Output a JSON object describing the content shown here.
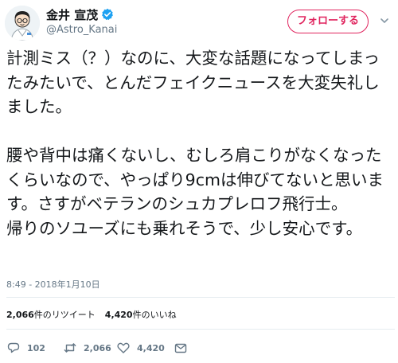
{
  "user": {
    "display_name": "金井 宣茂",
    "handle": "@Astro_Kanai",
    "verified_icon": "verified-badge-icon"
  },
  "follow_button": {
    "label": "フォローする"
  },
  "tweet": {
    "text": "計測ミス（？）なのに、大変な話題になってしまったみたいで、とんだフェイクニュースを大変失礼しました。\n\n腰や背中は痛くないし、むしろ肩こりがなくなったくらいなので、やっぱり9cmは伸びてないと思います。さすがベテランのシュカプレロフ飛行士。\n帰りのソユーズにも乗れそうで、少し安心です。",
    "timestamp": "8:49 - 2018年1月10日"
  },
  "stats": {
    "retweets_count": "2,066",
    "retweets_label": "件のリツイート",
    "likes_count": "4,420",
    "likes_label": "件のいいね"
  },
  "actions": {
    "reply_count": "102",
    "retweet_count": "2,066",
    "like_count": "4,420"
  },
  "colors": {
    "follow_accent": "#e0245e",
    "verified": "#1da1f2",
    "secondary_text": "#657786"
  }
}
